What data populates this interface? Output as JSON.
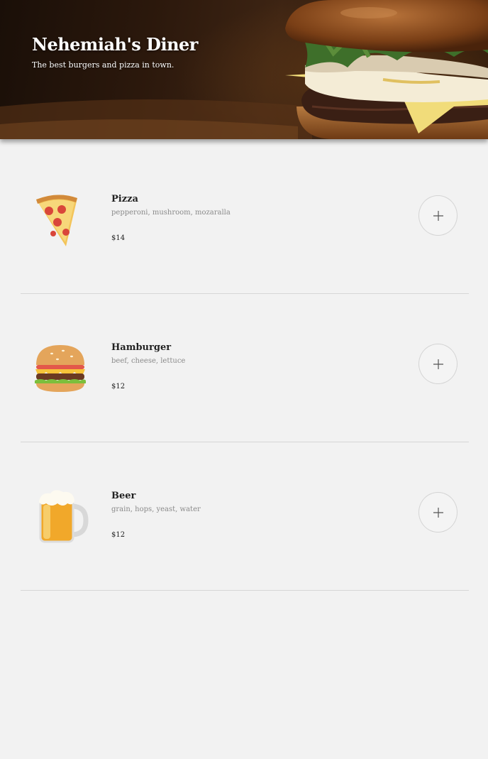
{
  "header": {
    "title": "Nehemiah's Diner",
    "subtitle": "The best burgers and pizza in town."
  },
  "menu": {
    "items": [
      {
        "name": "Pizza",
        "description": "pepperoni, mushroom, mozaralla",
        "price": "$14",
        "icon": "pizza-icon"
      },
      {
        "name": "Hamburger",
        "description": "beef, cheese, lettuce",
        "price": "$12",
        "icon": "hamburger-icon"
      },
      {
        "name": "Beer",
        "description": "grain, hops, yeast, water",
        "price": "$12",
        "icon": "beer-icon"
      }
    ]
  },
  "colors": {
    "background": "#f2f2f2",
    "divider": "#d6d6d6",
    "description": "#8a8a8a"
  }
}
